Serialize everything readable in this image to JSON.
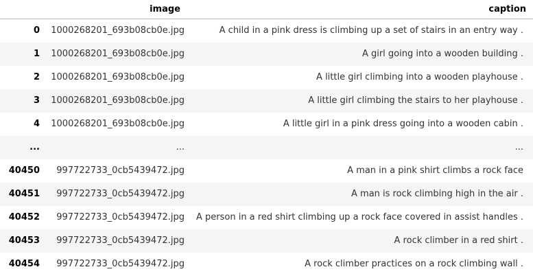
{
  "table": {
    "columns": [
      "image",
      "caption"
    ],
    "rows": [
      {
        "index": "0",
        "image": "1000268201_693b08cb0e.jpg",
        "caption": "A child in a pink dress is climbing up a set of stairs in an entry way ."
      },
      {
        "index": "1",
        "image": "1000268201_693b08cb0e.jpg",
        "caption": "A girl going into a wooden building ."
      },
      {
        "index": "2",
        "image": "1000268201_693b08cb0e.jpg",
        "caption": "A little girl climbing into a wooden playhouse ."
      },
      {
        "index": "3",
        "image": "1000268201_693b08cb0e.jpg",
        "caption": "A little girl climbing the stairs to her playhouse ."
      },
      {
        "index": "4",
        "image": "1000268201_693b08cb0e.jpg",
        "caption": "A little girl in a pink dress going into a wooden cabin ."
      },
      {
        "index": "...",
        "image": "...",
        "caption": "..."
      },
      {
        "index": "40450",
        "image": "997722733_0cb5439472.jpg",
        "caption": "A man in a pink shirt climbs a rock face"
      },
      {
        "index": "40451",
        "image": "997722733_0cb5439472.jpg",
        "caption": "A man is rock climbing high in the air ."
      },
      {
        "index": "40452",
        "image": "997722733_0cb5439472.jpg",
        "caption": "A person in a red shirt climbing up a rock face covered in assist handles ."
      },
      {
        "index": "40453",
        "image": "997722733_0cb5439472.jpg",
        "caption": "A rock climber in a red shirt ."
      },
      {
        "index": "40454",
        "image": "997722733_0cb5439472.jpg",
        "caption": "A rock climber practices on a rock climbing wall ."
      }
    ]
  }
}
